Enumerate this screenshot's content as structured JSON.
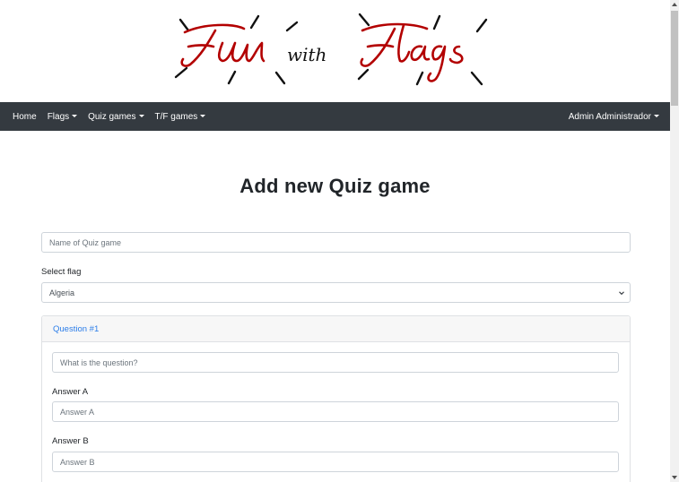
{
  "logo": {
    "alt": "Fun with Flags"
  },
  "navbar": {
    "items": [
      {
        "label": "Home",
        "dropdown": false
      },
      {
        "label": "Flags",
        "dropdown": true
      },
      {
        "label": "Quiz games",
        "dropdown": true
      },
      {
        "label": "T/F games",
        "dropdown": true
      }
    ],
    "user": {
      "label": "Admin Administrador",
      "dropdown": true
    },
    "background": "#343a40"
  },
  "page": {
    "title": "Add new Quiz game"
  },
  "form": {
    "name_input": {
      "placeholder": "Name of Quiz game",
      "value": ""
    },
    "flag_select": {
      "label": "Select flag",
      "value": "Algeria"
    },
    "question_card": {
      "header": "Question #1",
      "question_input": {
        "placeholder": "What is the question?",
        "value": ""
      },
      "answers": [
        {
          "label": "Answer A",
          "placeholder": "Answer A",
          "value": ""
        },
        {
          "label": "Answer B",
          "placeholder": "Answer B",
          "value": ""
        }
      ]
    }
  },
  "colors": {
    "accent": "#b30000",
    "link": "#2b7de9"
  }
}
